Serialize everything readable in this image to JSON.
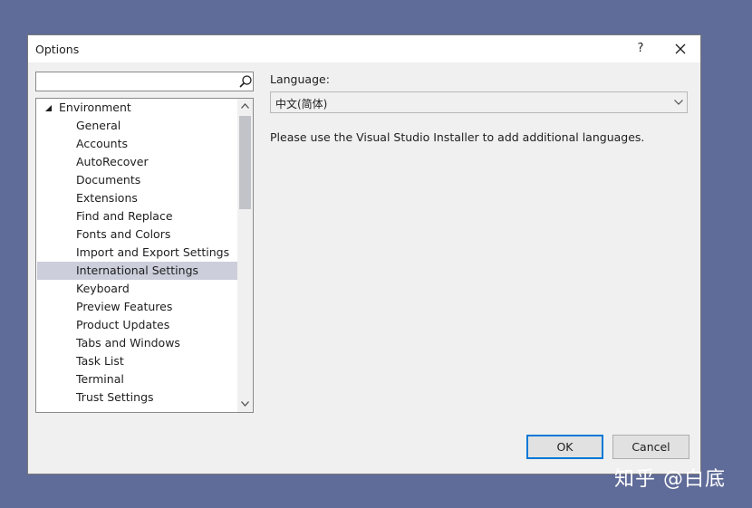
{
  "window": {
    "title": "Options",
    "help_glyph": "?"
  },
  "search": {
    "placeholder": "",
    "value": ""
  },
  "tree": {
    "root_label": "Environment",
    "items": [
      "General",
      "Accounts",
      "AutoRecover",
      "Documents",
      "Extensions",
      "Find and Replace",
      "Fonts and Colors",
      "Import and Export Settings",
      "International Settings",
      "Keyboard",
      "Preview Features",
      "Product Updates",
      "Tabs and Windows",
      "Task List",
      "Terminal",
      "Trust Settings"
    ],
    "selected": "International Settings"
  },
  "panel": {
    "language_label": "Language:",
    "language_value": "中文(简体)",
    "info": "Please use the Visual Studio Installer to add additional languages."
  },
  "buttons": {
    "ok": "OK",
    "cancel": "Cancel"
  },
  "watermark": "知乎 @白底",
  "colors": {
    "desktop": "#5f6b98",
    "selection": "#cccedb",
    "accent": "#0078d7"
  }
}
